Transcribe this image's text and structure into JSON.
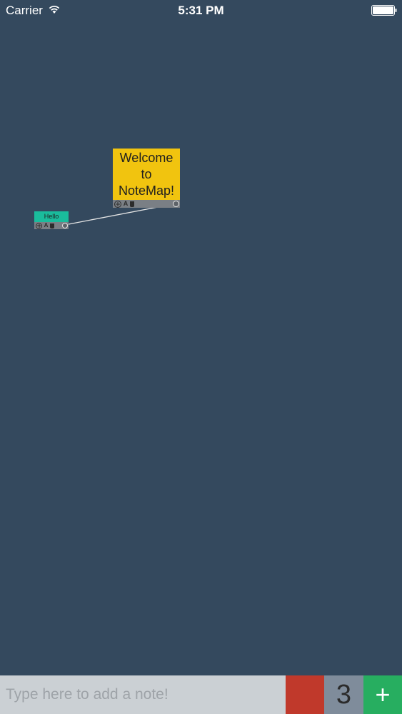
{
  "status_bar": {
    "carrier": "Carrier",
    "time": "5:31 PM",
    "wifi_icon": "wifi-icon",
    "battery_icon": "battery-icon"
  },
  "canvas": {
    "background_color": "#34495e",
    "notes": [
      {
        "text": "Welcome to NoteMap!",
        "color": "#f1c40f",
        "toolbar_icons": [
          "move-icon",
          "font-icon",
          "trash-icon",
          "link-handle-icon"
        ]
      },
      {
        "text": "Hello",
        "color": "#1abc9c",
        "toolbar_icons": [
          "move-icon",
          "font-icon",
          "trash-icon",
          "link-handle-icon"
        ]
      }
    ],
    "connection": {
      "from": "Hello",
      "to": "Welcome to NoteMap!"
    }
  },
  "bottom_bar": {
    "input_placeholder": "Type here to add a note!",
    "input_value": "",
    "color_swatch": "#c0392b",
    "size_value": "3",
    "add_label": "+",
    "add_color": "#27ae60"
  }
}
